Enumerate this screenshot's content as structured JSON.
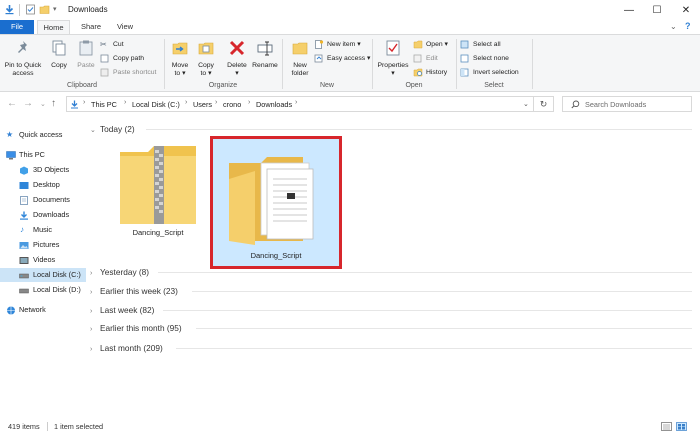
{
  "window": {
    "title": "Downloads",
    "controls": {
      "minimize": "—",
      "maximize": "☐",
      "close": "✕"
    }
  },
  "ribbon_tabs": [
    {
      "label": "File"
    },
    {
      "label": "Home"
    },
    {
      "label": "Share"
    },
    {
      "label": "View"
    }
  ],
  "ribbon": {
    "clipboard": {
      "label": "Clipboard",
      "pin_to_quick_access": [
        "Pin to Quick",
        "access"
      ],
      "copy": "Copy",
      "paste": "Paste",
      "cut": "Cut",
      "copy_path": "Copy path",
      "paste_shortcut": "Paste shortcut"
    },
    "organize": {
      "label": "Organize",
      "move_to": [
        "Move",
        "to ▾"
      ],
      "copy_to": [
        "Copy",
        "to ▾"
      ],
      "delete": [
        "Delete",
        "▾"
      ],
      "rename": "Rename"
    },
    "new": {
      "label": "New",
      "new_folder": [
        "New",
        "folder"
      ],
      "new_item": "New item ▾",
      "easy_access": "Easy access ▾"
    },
    "open": {
      "label": "Open",
      "properties": [
        "Properties",
        "▾"
      ],
      "open": "Open ▾",
      "edit": "Edit",
      "history": "History"
    },
    "select": {
      "label": "Select",
      "select_all": "Select all",
      "select_none": "Select none",
      "invert_selection": "Invert selection"
    }
  },
  "address": {
    "crumbs": [
      "This PC",
      "Local Disk (C:)",
      "Users",
      "crono",
      "Downloads"
    ],
    "search_placeholder": "Search Downloads"
  },
  "navpane": {
    "items": [
      {
        "label": "Quick access",
        "icon": "star-icon",
        "color": "#2f7fd3"
      },
      {
        "label": "This PC",
        "icon": "computer-icon",
        "color": "#3a8ee6"
      },
      {
        "label": "3D Objects",
        "icon": "cube-icon",
        "color": "#41a0e8"
      },
      {
        "label": "Desktop",
        "icon": "desktop-icon",
        "color": "#2f86d9"
      },
      {
        "label": "Documents",
        "icon": "document-icon",
        "color": "#6d8fb2"
      },
      {
        "label": "Downloads",
        "icon": "download-icon",
        "color": "#2f86d9"
      },
      {
        "label": "Music",
        "icon": "music-icon",
        "color": "#2f86d9"
      },
      {
        "label": "Pictures",
        "icon": "picture-icon",
        "color": "#4a9ae0"
      },
      {
        "label": "Videos",
        "icon": "video-icon",
        "color": "#555"
      },
      {
        "label": "Local Disk (C:)",
        "icon": "drive-icon",
        "color": "#777"
      },
      {
        "label": "Local Disk (D:)",
        "icon": "drive-icon",
        "color": "#777"
      },
      {
        "label": "Network",
        "icon": "network-icon",
        "color": "#2f86d9"
      }
    ]
  },
  "groups": [
    {
      "label": "Today (2)",
      "expanded": true
    },
    {
      "label": "Yesterday (8)",
      "expanded": false
    },
    {
      "label": "Earlier this week (23)",
      "expanded": false
    },
    {
      "label": "Last week (82)",
      "expanded": false
    },
    {
      "label": "Earlier this month (95)",
      "expanded": false
    },
    {
      "label": "Last month (209)",
      "expanded": false
    }
  ],
  "files": [
    {
      "name": "Dancing_Script",
      "type": "zip-folder",
      "selected": false
    },
    {
      "name": "Dancing_Script",
      "type": "folder",
      "selected": true
    }
  ],
  "status": {
    "item_count": "419 items",
    "selection": "1 item selected"
  },
  "colors": {
    "accent": "#1a6ecf",
    "selection_bg": "#cce8ff",
    "highlight_box": "#d7262c",
    "folder": "#f5cf6b"
  }
}
